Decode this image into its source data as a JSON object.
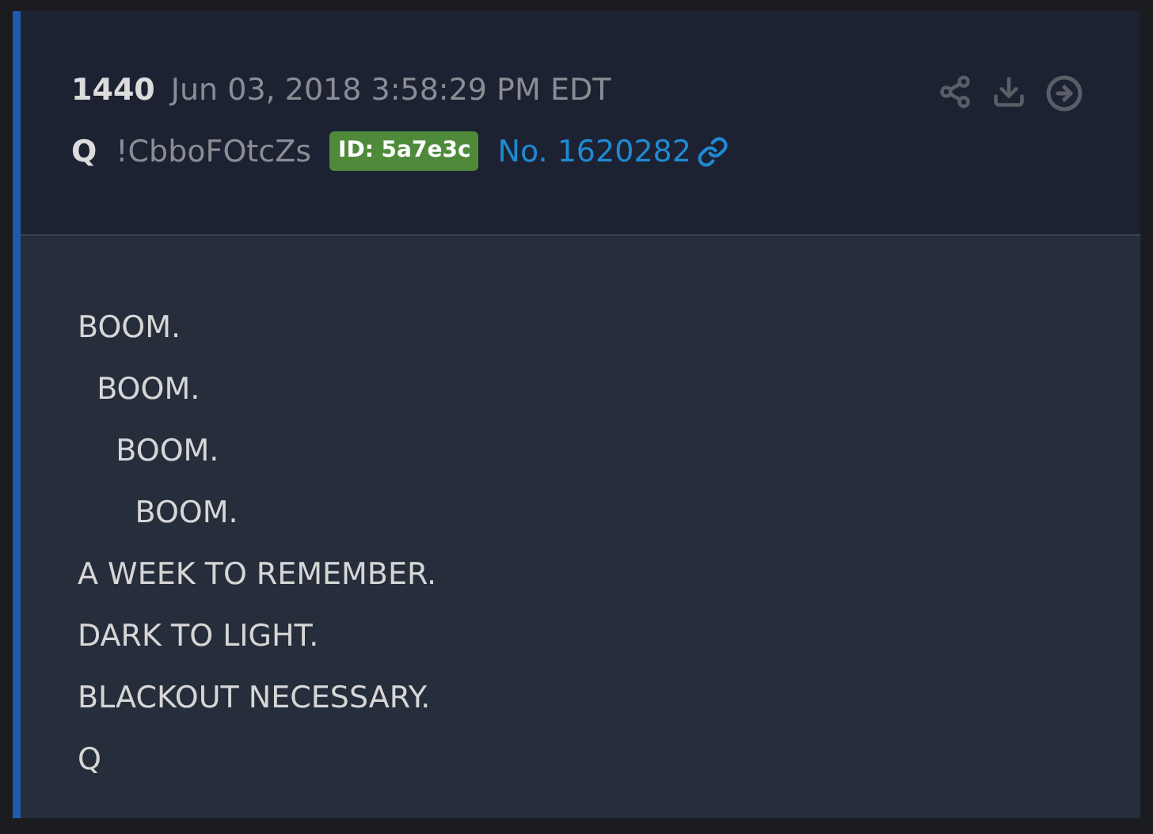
{
  "post": {
    "number": "1440",
    "timestamp": "Jun 03, 2018 3:58:29 PM EDT",
    "author": "Q",
    "tripcode": "!CbboFOtcZs",
    "id_badge": "ID: 5a7e3c",
    "post_link": "No. 1620282",
    "body": [
      "BOOM.",
      "  BOOM.",
      "    BOOM.",
      "      BOOM.",
      "A WEEK TO REMEMBER.",
      "DARK TO LIGHT.",
      "BLACKOUT NECESSARY.",
      "Q"
    ]
  }
}
